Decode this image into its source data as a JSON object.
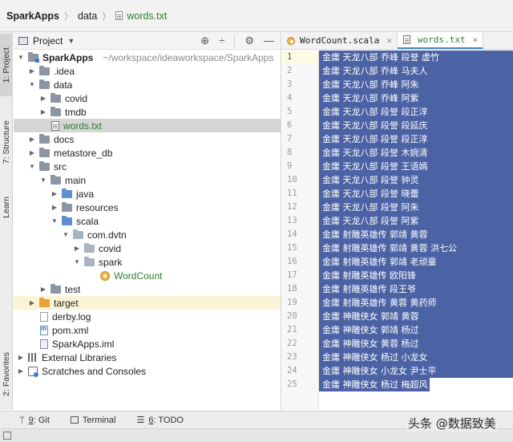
{
  "breadcrumb": [
    "SparkApps",
    "data",
    "words.txt"
  ],
  "left_strip": {
    "project_tab": "1: Project",
    "structure_tab": "7: Structure",
    "learn_tab": "Learn",
    "favorites_tab": "2: Favorites"
  },
  "project_panel": {
    "title": "Project",
    "tree": [
      {
        "label": "SparkApps",
        "path": "~/workspace/ideaworkspace/SparkApps"
      },
      {
        "label": ".idea"
      },
      {
        "label": "data"
      },
      {
        "label": "covid"
      },
      {
        "label": "tmdb"
      },
      {
        "label": "words.txt"
      },
      {
        "label": "docs"
      },
      {
        "label": "metastore_db"
      },
      {
        "label": "src"
      },
      {
        "label": "main"
      },
      {
        "label": "java"
      },
      {
        "label": "resources"
      },
      {
        "label": "scala"
      },
      {
        "label": "com.dvtn"
      },
      {
        "label": "covid"
      },
      {
        "label": "spark"
      },
      {
        "label": "WordCount"
      },
      {
        "label": "test"
      },
      {
        "label": "target"
      },
      {
        "label": "derby.log"
      },
      {
        "label": "pom.xml"
      },
      {
        "label": "SparkApps.iml"
      },
      {
        "label": "External Libraries"
      },
      {
        "label": "Scratches and Consoles"
      }
    ]
  },
  "editor": {
    "tabs": [
      {
        "label": "WordCount.scala"
      },
      {
        "label": "words.txt"
      }
    ],
    "lines": [
      "金庸 天龙八部 乔峰 段誉 虚竹",
      "金庸 天龙八部 乔峰 马夫人",
      "金庸 天龙八部 乔峰 阿朱",
      "金庸 天龙八部 乔峰 阿紫",
      "金庸 天龙八部 段誉 段正淳",
      "金庸 天龙八部 段誉 段延庆",
      "金庸 天龙八部 段誉 段正淳",
      "金庸 天龙八部 段誉 木婉清",
      "金庸 天龙八部 段誉 王语嫣",
      "金庸 天龙八部 段誉 钟灵",
      "金庸 天龙八部 段誉 晓蕾",
      "金庸 天龙八部 段誉 阿朱",
      "金庸 天龙八部 段誉 阿紫",
      "金庸 射雕英雄传 郭靖 黄蓉",
      "金庸 射雕英雄传 郭靖 黄蓉 洪七公",
      "金庸 射雕英雄传 郭靖 老顽童",
      "金庸 射雕英雄传 欧阳锋",
      "金庸 射雕英雄传 段王爷",
      "金庸 射雕英雄传 黄蓉 黄药师",
      "金庸 神雕侠女 郭靖 黄蓉",
      "金庸 神雕侠女 郭靖 杨过",
      "金庸 神雕侠女 黄蓉 杨过",
      "金庸 神雕侠女 杨过 小龙女",
      "金庸 神雕侠女 小龙女 尹士平",
      "金庸 神雕侠女 杨过 梅超风"
    ],
    "line_numbers": [
      "1",
      "2",
      "3",
      "4",
      "5",
      "6",
      "7",
      "8",
      "9",
      "10",
      "11",
      "12",
      "13",
      "14",
      "15",
      "16",
      "17",
      "18",
      "19",
      "20",
      "21",
      "22",
      "23",
      "24",
      "25"
    ],
    "selection_color": "#4b62a4"
  },
  "bottom_bar": {
    "git_num": "9",
    "git_label": ": Git",
    "terminal_label": "Terminal",
    "todo_num": "6",
    "todo_label": ": TODO"
  },
  "watermark": "头条 @数据致美"
}
